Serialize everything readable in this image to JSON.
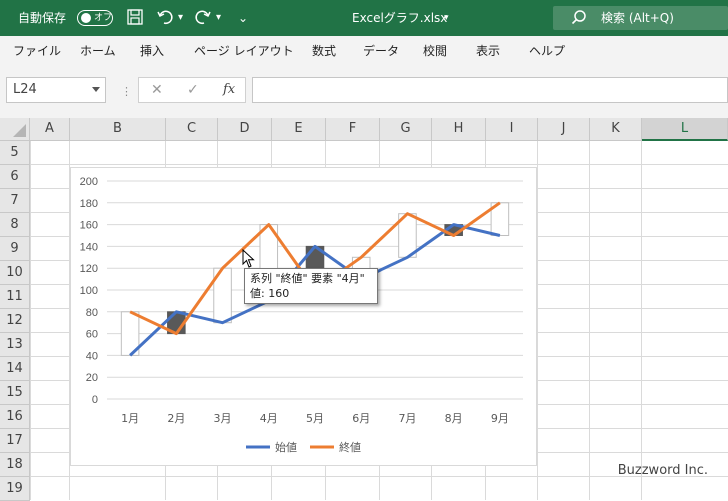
{
  "titlebar": {
    "autosave_label": "自動保存",
    "autosave_state": "オフ",
    "filename": "Excelグラフ.xlsx",
    "search_placeholder": "検索 (Alt+Q)"
  },
  "ribbon": {
    "tabs": [
      "ファイル",
      "ホーム",
      "挿入",
      "ページ レイアウト",
      "数式",
      "データ",
      "校閲",
      "表示",
      "ヘルプ"
    ]
  },
  "formula_bar": {
    "name_box": "L24",
    "fx": "fx",
    "content": ""
  },
  "sheet": {
    "columns": [
      "A",
      "B",
      "C",
      "D",
      "E",
      "F",
      "G",
      "H",
      "I",
      "J",
      "K",
      "L"
    ],
    "rows": [
      "5",
      "6",
      "7",
      "8",
      "9",
      "10",
      "11",
      "12",
      "13",
      "14",
      "15",
      "16",
      "17",
      "18",
      "19"
    ],
    "selected_column": "L"
  },
  "chart_data": {
    "type": "line",
    "categories": [
      "1月",
      "2月",
      "3月",
      "4月",
      "5月",
      "6月",
      "7月",
      "8月",
      "9月"
    ],
    "series": [
      {
        "name": "始値",
        "color": "#4472C4",
        "values": [
          40,
          80,
          70,
          90,
          140,
          110,
          130,
          160,
          150
        ]
      },
      {
        "name": "終値",
        "color": "#ED7D31",
        "values": [
          80,
          60,
          120,
          160,
          100,
          130,
          170,
          150,
          180
        ]
      }
    ],
    "y_ticks": [
      "0",
      "20",
      "40",
      "60",
      "80",
      "100",
      "120",
      "140",
      "160",
      "180",
      "200"
    ],
    "ylim": [
      0,
      200
    ],
    "up_bar_color": "#ffffff",
    "down_bar_color": "#595959",
    "legend_position": "bottom",
    "grid": true
  },
  "tooltip": {
    "line1": "系列 \"終値\" 要素 \"4月\"",
    "line2": "値: 160"
  },
  "watermark": "Buzzword Inc."
}
